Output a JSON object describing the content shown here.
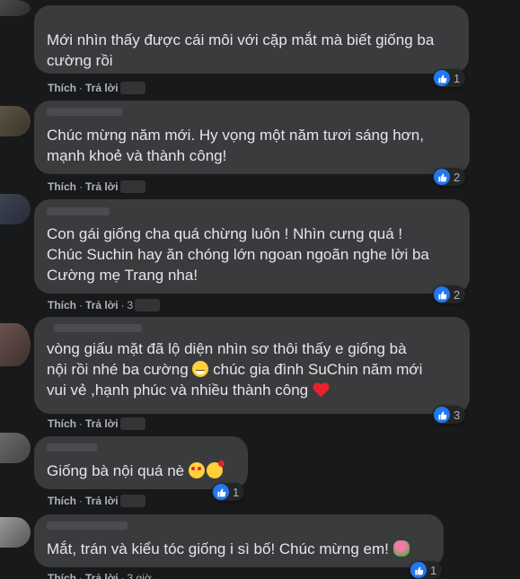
{
  "labels": {
    "like": "Thích",
    "reply": "Trả lời",
    "sep": "·"
  },
  "comments": [
    {
      "text": "Mới nhìn thấy được cái môi với cặp mắt mà biết giống ba\ncường rồi",
      "likes": "1"
    },
    {
      "text": "Chúc mừng năm mới. Hy vọng một năm tươi sáng hơn,\nmạnh khoẻ và thành công!",
      "likes": "2"
    },
    {
      "text": "Con gái giống cha quá chừng luôn ! Nhìn cưng quá !\nChúc Suchin hay ăn chóng lớn ngoan ngoãn nghe lời ba\nCường mẹ Trang nha!",
      "likes": "2",
      "time": "3"
    },
    {
      "text_a": "vòng giấu mặt đã lộ diện nhìn sơ thôi thấy e giống bà\nnội rồi nhé ba cường ",
      "text_b": " chúc gia đình SuChin năm mới\nvui vẻ ,hạnh phúc và nhiều thành công ",
      "likes": "3"
    },
    {
      "text": "Giống bà nội quá nè ",
      "likes": "1"
    },
    {
      "text": "Mắt, trán và kiểu tóc giống i sì bố! Chúc mừng em! ",
      "likes": "1",
      "time": "3 giờ"
    }
  ],
  "icons": {
    "like": "like-thumb-icon",
    "emojis": [
      "grinning-sweat-emoji",
      "red-heart-emoji",
      "heart-eyes-emoji",
      "smiling-hearts-emoji",
      "bouquet-emoji"
    ]
  },
  "colors": {
    "background": "#18191a",
    "bubble": "#3a3b3c",
    "like_blue": "#2078f4",
    "secondary_text": "#b0b3b8"
  }
}
